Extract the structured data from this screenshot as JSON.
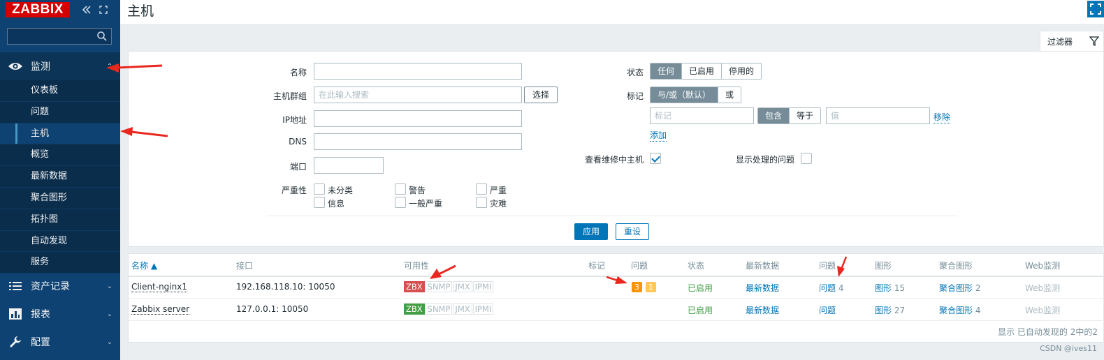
{
  "sidebar": {
    "logo": "ZABBIX",
    "collapse_icon": "double-chevron-left-icon",
    "kiosk_icon": "expand-icon",
    "search": {
      "placeholder": "",
      "value": ""
    },
    "main_items": [
      {
        "label": "监测",
        "icon": "eye-icon",
        "expanded": true
      },
      {
        "label": "资产记录",
        "icon": "list-icon"
      },
      {
        "label": "报表",
        "icon": "bar-chart-icon"
      },
      {
        "label": "配置",
        "icon": "wrench-icon"
      }
    ],
    "monitor_subitems": [
      "仪表板",
      "问题",
      "主机",
      "概览",
      "最新数据",
      "聚合图形",
      "拓扑图",
      "自动发现",
      "服务"
    ],
    "active_subitem": "主机"
  },
  "header": {
    "title": "主机"
  },
  "filter_tab": {
    "label": "过滤器"
  },
  "filter": {
    "name_label": "名称",
    "name_value": "",
    "host_group_label": "主机群组",
    "host_group_placeholder": "在此输入搜索",
    "select_button": "选择",
    "ip_label": "IP地址",
    "dns_label": "DNS",
    "port_label": "端口",
    "severity_label": "严重性",
    "severities": [
      "未分类",
      "警告",
      "严重",
      "信息",
      "一般严重",
      "灾难"
    ],
    "status_label": "状态",
    "status_options": [
      "任何",
      "已启用",
      "停用的"
    ],
    "status_selected": "任何",
    "tags_label": "标记",
    "tag_logic_options": [
      "与/或（默认）",
      "或"
    ],
    "tag_logic_selected": "与/或（默认）",
    "tag_name_placeholder": "标记",
    "tag_operator_options": [
      "包含",
      "等于"
    ],
    "tag_operator_selected": "包含",
    "tag_value_placeholder": "值",
    "remove_link": "移除",
    "add_link": "添加",
    "maintenance_label": "查看维修中主机",
    "maintenance_checked": true,
    "suppressed_label": "显示处理的问题",
    "suppressed_checked": false,
    "apply_button": "应用",
    "reset_button": "重设"
  },
  "table": {
    "columns": [
      "名称 ▲",
      "接口",
      "可用性",
      "标记",
      "问题",
      "状态",
      "最新数据",
      "问题",
      "图形",
      "聚合图形",
      "Web监测"
    ],
    "rows": [
      {
        "name": "Client-nginx1",
        "interface": "192.168.118.10: 10050",
        "availability": [
          "ZBX",
          "SNMP",
          "JMX",
          "IPMI"
        ],
        "zbx_status": "red",
        "problems": [
          {
            "count": "3",
            "color": "#f89406"
          },
          {
            "count": "1",
            "color": "#ffc859"
          }
        ],
        "status": "已启用",
        "latest_data": "最新数据",
        "problems_link": "问题",
        "problems_count": "4",
        "graphs_link": "图形",
        "graphs_count": "15",
        "screens_link": "聚合图形",
        "screens_count": "2",
        "web": "Web监测"
      },
      {
        "name": "Zabbix server",
        "interface": "127.0.0.1: 10050",
        "availability": [
          "ZBX",
          "SNMP",
          "JMX",
          "IPMI"
        ],
        "zbx_status": "green",
        "problems": [],
        "status": "已启用",
        "latest_data": "最新数据",
        "problems_link": "问题",
        "problems_count": "",
        "graphs_link": "图形",
        "graphs_count": "27",
        "screens_link": "聚合图形",
        "screens_count": "4",
        "web": "Web监测"
      }
    ],
    "footer": "显示 已自动发现的 2中的2"
  },
  "watermark": "CSDN @ives11",
  "colors": {
    "sidebar": "#0e4272",
    "accent": "#0275b8",
    "logo": "#d40000",
    "annotation_arrow": "#e8281f"
  }
}
